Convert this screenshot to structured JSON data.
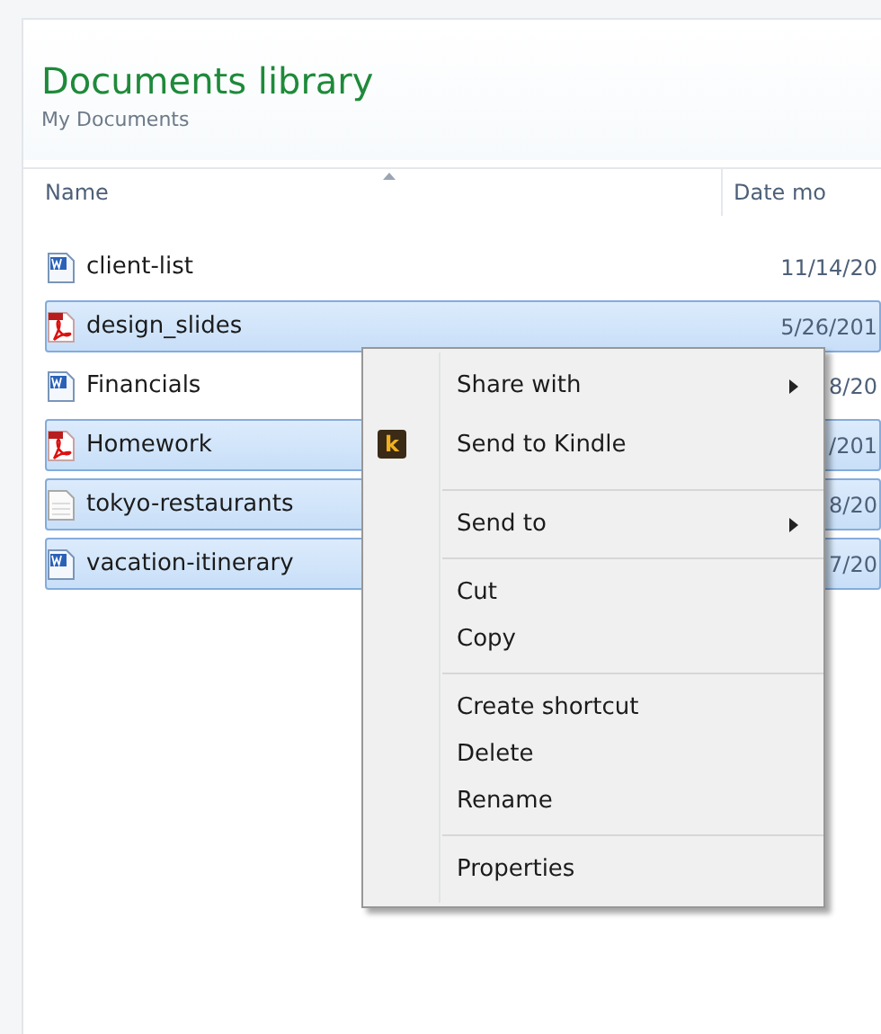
{
  "library": {
    "title": "Documents library",
    "subtitle": "My Documents"
  },
  "columns": [
    "Name",
    "Date mo"
  ],
  "files": [
    {
      "name": "client-list",
      "kind": "word",
      "date": "11/14/20",
      "selected": false
    },
    {
      "name": "design_slides",
      "kind": "pdf",
      "date": "5/26/201",
      "selected": true
    },
    {
      "name": "Financials",
      "kind": "word",
      "date": "8/20",
      "selected": false
    },
    {
      "name": "Homework",
      "kind": "pdf",
      "date": "/201",
      "selected": true
    },
    {
      "name": "tokyo-restaurants",
      "kind": "text",
      "date": "8/20",
      "selected": true
    },
    {
      "name": "vacation-itinerary",
      "kind": "word",
      "date": "7/20",
      "selected": true
    }
  ],
  "context_menu": [
    [
      {
        "label": "Share with",
        "kind": "submenu"
      },
      {
        "label": "Send to Kindle",
        "kind": "app",
        "icon": "k"
      }
    ],
    [
      {
        "label": "Send to",
        "kind": "submenu"
      }
    ],
    [
      {
        "label": "Cut",
        "kind": "plain"
      },
      {
        "label": "Copy",
        "kind": "plain"
      }
    ],
    [
      {
        "label": "Create shortcut",
        "kind": "plain"
      },
      {
        "label": "Delete",
        "kind": "plain"
      },
      {
        "label": "Rename",
        "kind": "plain"
      }
    ],
    [
      {
        "label": "Properties",
        "kind": "plain"
      }
    ]
  ]
}
